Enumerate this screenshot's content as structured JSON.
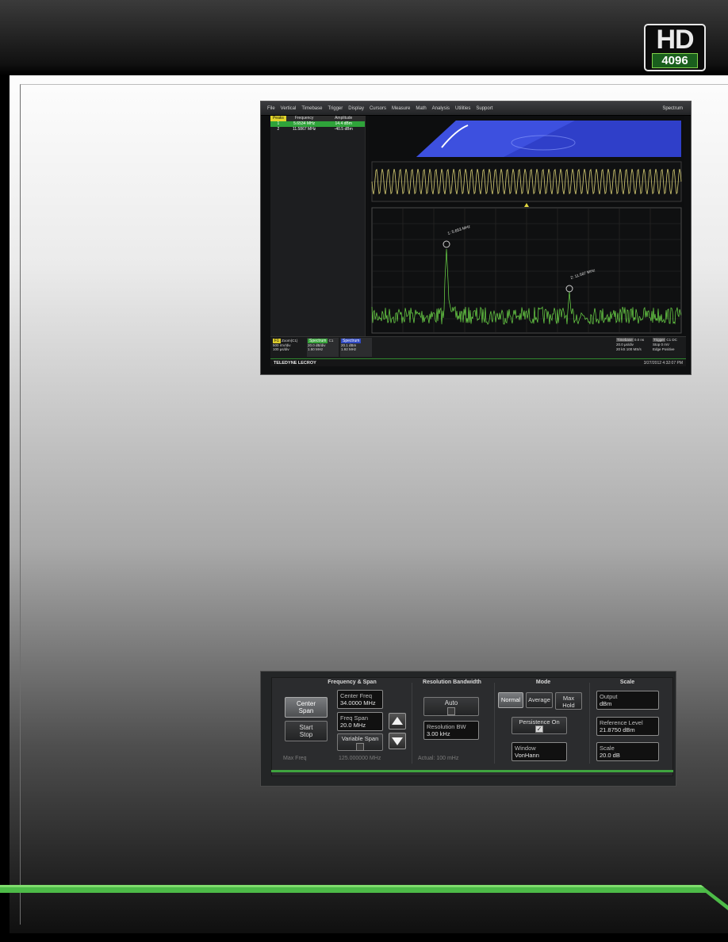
{
  "logo": {
    "text": "HD",
    "number": "4096"
  },
  "scope": {
    "menu": [
      "File",
      "Vertical",
      "Timebase",
      "Trigger",
      "Display",
      "Cursors",
      "Measure",
      "Math",
      "Analysis",
      "Utilities",
      "Support"
    ],
    "mode_label": "Spectrum",
    "peaks": {
      "header": [
        "Peaks",
        "Frequency",
        "Amplitude"
      ],
      "rows": [
        [
          "1",
          "5.6534 MHz",
          "14.4 dBm"
        ],
        [
          "2",
          "11.5867 MHz",
          "-40.5 dBm"
        ]
      ]
    },
    "markers": [
      "1: 5.653 MHz",
      "2: 11.587 MHz"
    ],
    "channels": [
      {
        "label": "F1",
        "title": "Zoom(C1)",
        "lines": [
          "500 mV/div",
          "100 µs/div"
        ]
      },
      {
        "label": "Spectrum",
        "title": "C1",
        "lines": [
          "20.0 dB/div",
          "1.50 MHz"
        ]
      },
      {
        "label": "Spectrum",
        "title": "",
        "lines": [
          "20.1 dBm",
          "1.92 MHz"
        ]
      }
    ],
    "timebase": {
      "label": "Timebase",
      "value": "0.0 ns",
      "lines": [
        "20.0 µs/div",
        "20 kS",
        "100 MS/s"
      ]
    },
    "trigger": {
      "label": "Trigger",
      "value": "C1 DC",
      "lines": [
        "Stop",
        "0 mV",
        "Edge",
        "Positive"
      ]
    },
    "brand": "TELEDYNE LECROY",
    "datetime": "3/27/2012 4:32:07 PM"
  },
  "dialog": {
    "sections": {
      "freq_span": "Frequency & Span",
      "rbw": "Resolution Bandwidth",
      "mode": "Mode",
      "scale": "Scale"
    },
    "center_span": "Center Span",
    "start_stop": "Start Stop",
    "center_freq": {
      "label": "Center Freq",
      "value": "34.0000 MHz"
    },
    "freq_span": {
      "label": "Freq Span",
      "value": "20.0 MHz"
    },
    "variable_span": "Variable Span",
    "max_freq_label": "Max Freq",
    "max_freq_value": "125.000000 MHz",
    "auto": "Auto",
    "resolution_bw": {
      "label": "Resolution BW",
      "value": "3.00 kHz"
    },
    "actual": "Actual: 100 mHz",
    "modes": [
      "Normal",
      "Average",
      "Max Hold"
    ],
    "persistence": "Persistence On",
    "window": {
      "label": "Window",
      "value": "VonHann"
    },
    "output": {
      "label": "Output",
      "value": "dBm"
    },
    "reference_level": {
      "label": "Reference Level",
      "value": "21.8750 dBm"
    },
    "scale": {
      "label": "Scale",
      "value": "20.0 dB"
    }
  },
  "colors": {
    "accent_green": "#3fa33f",
    "trace_green": "#6fdc4a",
    "trace_yellow": "#d8cf74",
    "persist_blue": "#3a4bd6"
  }
}
